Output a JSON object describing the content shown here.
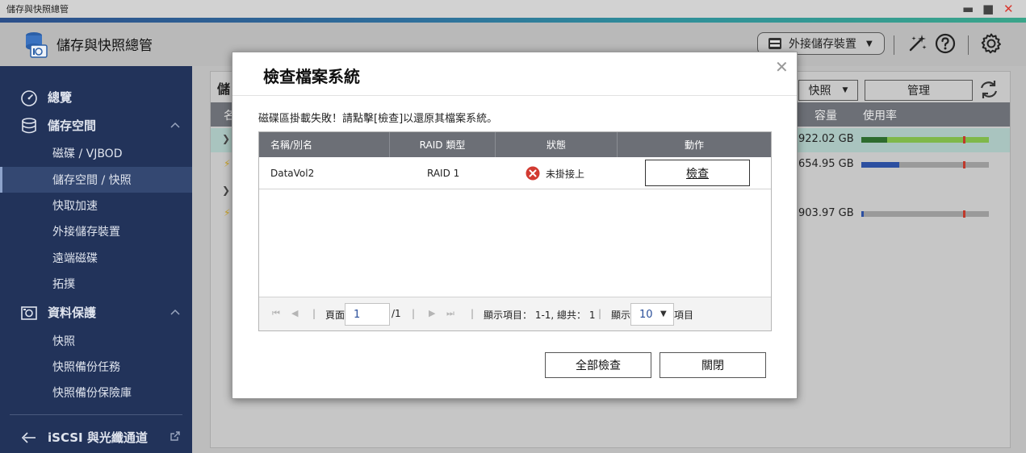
{
  "window": {
    "title": "儲存與快照總管"
  },
  "header": {
    "app_title": "儲存與快照總管",
    "external_storage_label": "外接儲存裝置"
  },
  "sidebar": {
    "items": [
      {
        "label": "總覽"
      },
      {
        "label": "儲存空間"
      },
      {
        "label": "磁碟 / VJBOD"
      },
      {
        "label": "儲存空間 / 快照"
      },
      {
        "label": "快取加速"
      },
      {
        "label": "外接儲存裝置"
      },
      {
        "label": "遠端磁碟"
      },
      {
        "label": "拓撲"
      },
      {
        "label": "資料保護"
      },
      {
        "label": "快照"
      },
      {
        "label": "快照備份任務"
      },
      {
        "label": "快照備份保險庫"
      },
      {
        "label": "iSCSI 與光纖通道"
      }
    ]
  },
  "main": {
    "heading": "儲",
    "snapshot_label": "快照",
    "manage_label": "管理",
    "columns": {
      "col0": "名",
      "capacity": "容量",
      "usage": "使用率"
    },
    "volumes": [
      {
        "capacity": "922.02 GB",
        "usage_fraction": 0.2,
        "usage_color": "#2e6b2e"
      },
      {
        "capacity": "654.95 GB",
        "usage_fraction": 0.3,
        "usage_color": "#2c4fa0"
      },
      {
        "capacity": "903.97 GB",
        "usage_fraction": 0.02,
        "usage_color": "#2c4fa0"
      }
    ]
  },
  "dialog": {
    "title": "檢查檔案系統",
    "message": "磁碟區掛載失敗！請點擊[檢查]以還原其檔案系統。",
    "columns": {
      "name": "名稱/別名",
      "raid": "RAID 類型",
      "status": "狀態",
      "action": "動作"
    },
    "rows": [
      {
        "name": "DataVol2",
        "raid": "RAID 1",
        "status": "未掛接上",
        "action": "檢查"
      }
    ],
    "pager": {
      "page_label": "頁面",
      "page_value": "1",
      "page_total": "/1",
      "display_items": "顯示項目： 1-1, 總共： 1",
      "show_label": "顯示",
      "per_page": "10",
      "items_label": "項目"
    },
    "check_all_label": "全部檢查",
    "close_label": "關閉"
  },
  "colors": {
    "sidebar": "#22335a",
    "accent": "#2a4f9a",
    "error": "#d23a31"
  }
}
